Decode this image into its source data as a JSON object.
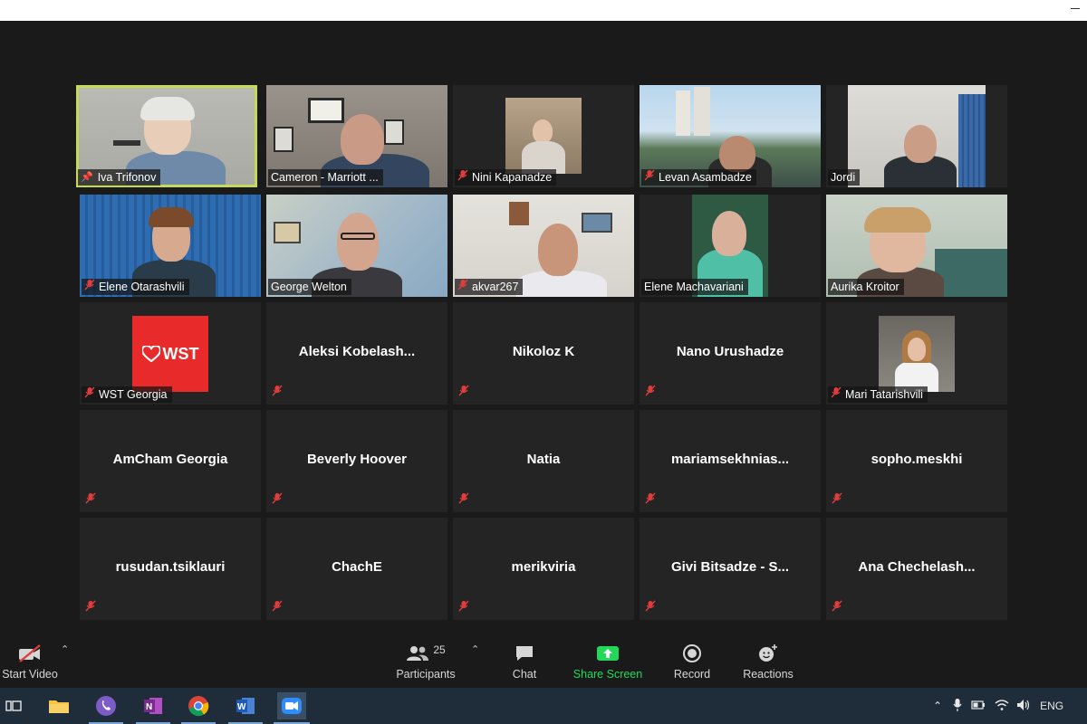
{
  "participants": [
    {
      "name": "Iva Trifonov",
      "video": true,
      "muted": false,
      "pinned": true,
      "active": true
    },
    {
      "name": "Cameron - Marriott ...",
      "video": true,
      "muted": false
    },
    {
      "name": "Nini Kapanadze",
      "video": true,
      "muted": true
    },
    {
      "name": "Levan Asambadze",
      "video": true,
      "muted": true
    },
    {
      "name": "Jordi",
      "video": true,
      "muted": false
    },
    {
      "name": "Elene Otarashvili",
      "video": true,
      "muted": true
    },
    {
      "name": "George Welton",
      "video": true,
      "muted": false
    },
    {
      "name": "akvar267",
      "video": true,
      "muted": true
    },
    {
      "name": "Elene Machavariani",
      "video": true,
      "muted": false
    },
    {
      "name": "Aurika Kroitor",
      "video": true,
      "muted": false
    },
    {
      "name": "WST Georgia",
      "video": false,
      "avatar": "WST",
      "muted": true
    },
    {
      "name": "Aleksi  Kobelash...",
      "video": false,
      "muted": true
    },
    {
      "name": "Nikoloz K",
      "video": false,
      "muted": true
    },
    {
      "name": "Nano Urushadze",
      "video": false,
      "muted": true
    },
    {
      "name": "Mari Tatarishvili",
      "video": false,
      "avatar": "photo",
      "muted": true
    },
    {
      "name": "AmCham Georgia",
      "video": false,
      "muted": true
    },
    {
      "name": "Beverly Hoover",
      "video": false,
      "muted": true
    },
    {
      "name": "Natia",
      "video": false,
      "muted": true
    },
    {
      "name": "mariamsekhnias...",
      "video": false,
      "muted": true
    },
    {
      "name": "sopho.meskhi",
      "video": false,
      "muted": true
    },
    {
      "name": "rusudan.tsiklauri",
      "video": false,
      "muted": true
    },
    {
      "name": "ChachE",
      "video": false,
      "muted": true
    },
    {
      "name": "merikviria",
      "video": false,
      "muted": true
    },
    {
      "name": "Givi Bitsadze - S...",
      "video": false,
      "muted": true
    },
    {
      "name": "Ana  Chechelash...",
      "video": false,
      "muted": true
    }
  ],
  "toolbar": {
    "start_video": "Start Video",
    "participants_label": "Participants",
    "participants_count": "25",
    "chat": "Chat",
    "share_screen": "Share Screen",
    "record": "Record",
    "reactions": "Reactions"
  },
  "taskbar": {
    "language": "ENG",
    "apps": [
      "task-view",
      "file-explorer",
      "viber",
      "onenote",
      "chrome",
      "word",
      "zoom"
    ]
  },
  "colors": {
    "background": "#1a1a1a",
    "tile": "#242424",
    "active_border": "#c5d85a",
    "mute_red": "#e03c3c",
    "share_green": "#23d959",
    "taskbar": "#1f2d3b"
  }
}
